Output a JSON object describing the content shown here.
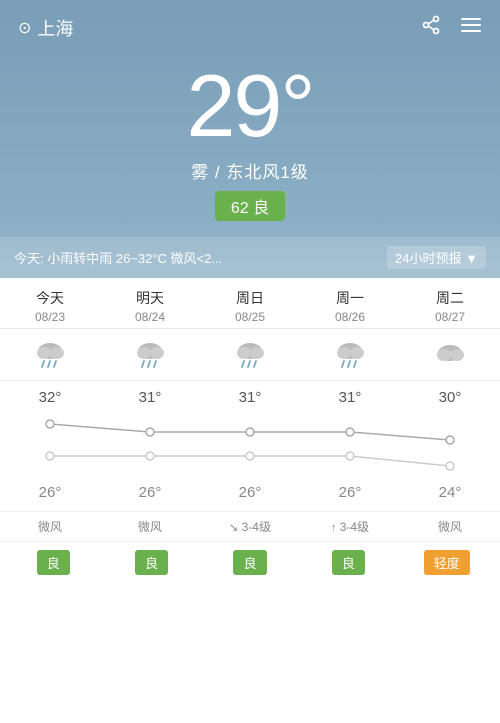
{
  "header": {
    "location": "上海",
    "location_icon": "⊙",
    "share_icon": "share",
    "menu_icon": "menu"
  },
  "main": {
    "temperature": "29",
    "degree_symbol": "°",
    "description": "雾 / 东北风1级",
    "aqi_value": "62",
    "aqi_label": "良"
  },
  "today_bar": {
    "text": "今天: 小雨转中雨  26~32°C  微风<2...",
    "link": "24小时预报",
    "arrow": "▼"
  },
  "forecast": {
    "columns": [
      {
        "day": "今天",
        "date": "08/23",
        "weather_icon": "cloud_rain",
        "temp_high": "32°",
        "temp_low": "26°",
        "wind": "微风",
        "wind_icon": "",
        "aqi": "良",
        "aqi_class": "good"
      },
      {
        "day": "明天",
        "date": "08/24",
        "weather_icon": "cloud_rain",
        "temp_high": "31°",
        "temp_low": "26°",
        "wind": "微风",
        "wind_icon": "",
        "aqi": "良",
        "aqi_class": "good"
      },
      {
        "day": "周日",
        "date": "08/25",
        "weather_icon": "cloud_rain",
        "temp_high": "31°",
        "temp_low": "26°",
        "wind": "3-4级",
        "wind_icon": "↘",
        "aqi": "良",
        "aqi_class": "good"
      },
      {
        "day": "周一",
        "date": "08/26",
        "weather_icon": "cloud_rain",
        "temp_high": "31°",
        "temp_low": "26°",
        "wind": "3-4级",
        "wind_icon": "↑",
        "aqi": "良",
        "aqi_class": "good"
      },
      {
        "day": "周二",
        "date": "08/27",
        "weather_icon": "cloud",
        "temp_high": "30°",
        "temp_low": "24°",
        "wind": "微风",
        "wind_icon": "",
        "aqi": "轻度",
        "aqi_class": "moderate"
      }
    ]
  }
}
